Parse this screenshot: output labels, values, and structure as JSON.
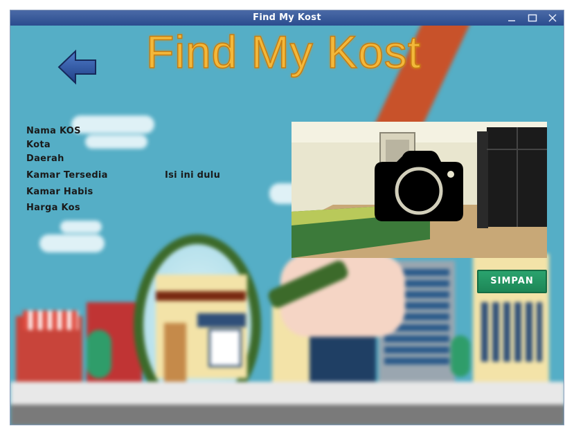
{
  "window": {
    "title": "Find My Kost"
  },
  "header": {
    "app_title": "Find My Kost"
  },
  "form": {
    "labels": {
      "nama_kos": "Nama KOS",
      "kota": "Kota",
      "daerah": "Daerah",
      "kamar_tersedia": "Kamar Tersedia",
      "kamar_habis": "Kamar Habis",
      "harga_kos": "Harga Kos"
    },
    "hint": "Isi ini dulu"
  },
  "photo": {
    "icon": "camera-icon"
  },
  "actions": {
    "save_label": "SIMPAN"
  },
  "icons": {
    "back": "back-arrow-icon",
    "minimize": "minimize-icon",
    "maximize": "maximize-icon",
    "close": "close-icon"
  },
  "colors": {
    "title": "#f3b83a",
    "save_button": "#2aa36e",
    "titlebar": "#3a5b9b"
  }
}
